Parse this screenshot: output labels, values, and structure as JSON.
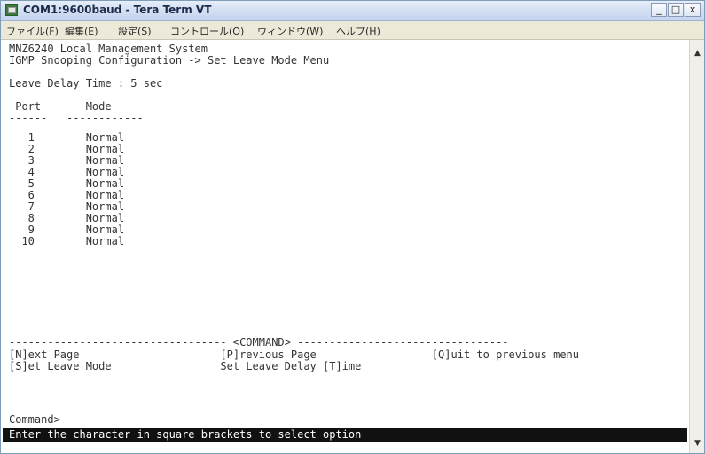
{
  "window": {
    "title": "COM1:9600baud - Tera Term VT",
    "buttons": {
      "minimize": "_",
      "maximize": "□",
      "close": "x"
    }
  },
  "menu": [
    "ファイル(F)",
    "編集(E)",
    "設定(S)",
    "コントロール(O)",
    "ウィンドウ(W)",
    "ヘルプ(H)"
  ],
  "terminal": {
    "system_title": "MNZ6240 Local Management System",
    "breadcrumb": "IGMP Snooping Configuration -> Set Leave Mode Menu",
    "leave_delay": "Leave Delay Time : 5 sec",
    "table": {
      "header": " Port       Mode",
      "separator": "------   ------------",
      "rows": [
        "   1        Normal",
        "   2        Normal",
        "   3        Normal",
        "   4        Normal",
        "   5        Normal",
        "   6        Normal",
        "   7        Normal",
        "   8        Normal",
        "   9        Normal",
        "  10        Normal"
      ]
    },
    "command_divider": "---------------------------------- <COMMAND> ---------------------------------",
    "commands": {
      "row1": "[N]ext Page                      [P]revious Page                  [Q]uit to previous menu",
      "row2": "[S]et Leave Mode                 Set Leave Delay [T]ime"
    },
    "prompt": "Command>",
    "status": "Enter the character in square brackets to select option"
  },
  "scrollbar": {
    "up": "▲",
    "down": "▼"
  }
}
